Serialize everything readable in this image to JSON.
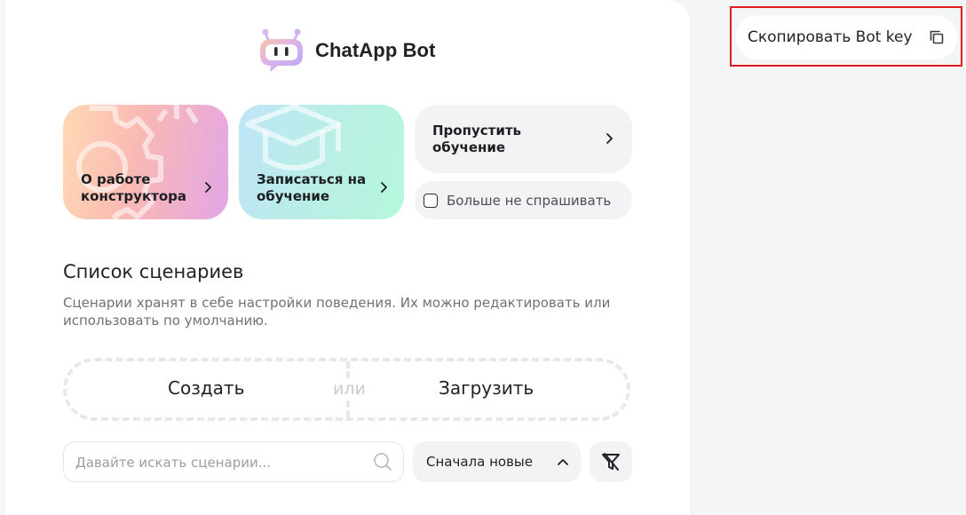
{
  "brand": {
    "name": "ChatApp Bot",
    "logo_icon": "chat-bot-logo-icon"
  },
  "cards": [
    {
      "label": "О работе\nконструктора",
      "icon": "gear-icon"
    },
    {
      "label": "Записаться на\nобучение",
      "icon": "graduation-cap-icon"
    }
  ],
  "skip": {
    "label": "Пропустить\nобучение"
  },
  "dont_ask": {
    "label": "Больше не спрашивать",
    "checked": false
  },
  "scenarios": {
    "title": "Список сценариев",
    "description": "Сценарии хранят в себе настройки поведения. Их можно редактировать или использовать по умолчанию.",
    "create_label": "Создать",
    "or_label": "или",
    "upload_label": "Загрузить"
  },
  "search": {
    "placeholder": "Давайте искать сценарии..."
  },
  "sort": {
    "selected": "Сначала новые"
  },
  "copy_key": {
    "label": "Скопировать Bot key",
    "icon": "copy-icon"
  },
  "colors": {
    "highlight": "#e01b24",
    "accent": "#c9a8f0"
  }
}
